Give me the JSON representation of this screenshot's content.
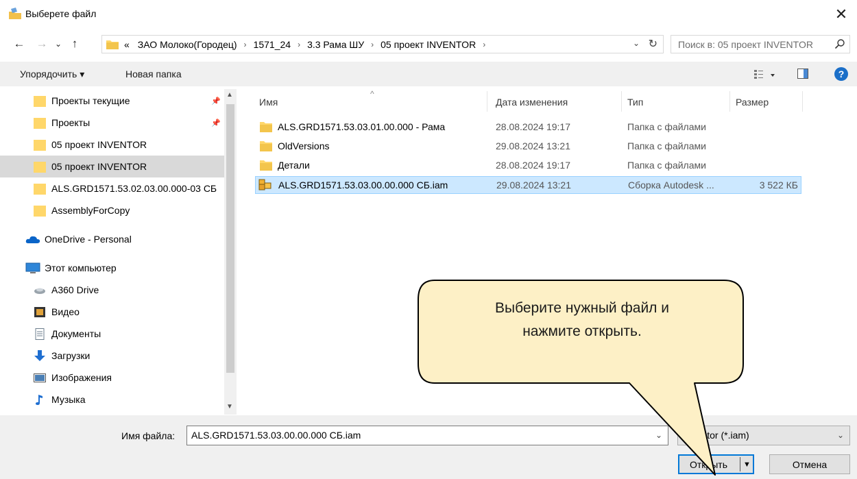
{
  "window": {
    "title": "Выберете файл",
    "close_glyph": "✕"
  },
  "nav": {
    "back_glyph": "←",
    "forward_glyph": "→",
    "recent_glyph": "⌄",
    "up_glyph": "↑",
    "breadcrumb": [
      "«",
      "ЗАО Молоко(Городец)",
      "1571_24",
      "3.3 Рама ШУ",
      "05 проект INVENTOR"
    ],
    "crumb_separator": "›",
    "dropdown_glyph": "⌄",
    "refresh_glyph": "↻",
    "search_placeholder": "Поиск в: 05 проект INVENTOR"
  },
  "toolbar": {
    "organize_label": "Упорядочить ▾",
    "new_folder_label": "Новая папка",
    "help_glyph": "?"
  },
  "sidebar": {
    "items": [
      {
        "label": "Проекты текущие",
        "icon": "folder-icon",
        "pinned": true
      },
      {
        "label": "Проекты",
        "icon": "folder-icon",
        "pinned": true
      },
      {
        "label": "05 проект INVENTOR",
        "icon": "folder-icon"
      },
      {
        "label": "05 проект INVENTOR",
        "icon": "folder-icon",
        "selected": true
      },
      {
        "label": "ALS.GRD1571.53.02.03.00.000-03 СБ",
        "icon": "folder-icon"
      },
      {
        "label": "AssemblyForCopy",
        "icon": "folder-icon"
      },
      {
        "label": "OneDrive - Personal",
        "icon": "cloud-icon"
      },
      {
        "label": "Этот компьютер",
        "icon": "computer-icon"
      },
      {
        "label": "A360 Drive",
        "icon": "drive-icon"
      },
      {
        "label": "Видео",
        "icon": "video-icon"
      },
      {
        "label": "Документы",
        "icon": "documents-icon"
      },
      {
        "label": "Загрузки",
        "icon": "downloads-icon"
      },
      {
        "label": "Изображения",
        "icon": "pictures-icon"
      },
      {
        "label": "Музыка",
        "icon": "music-icon"
      }
    ],
    "pin_glyph": "📌"
  },
  "filelist": {
    "columns": {
      "name": "Имя",
      "date": "Дата изменения",
      "type": "Тип",
      "size": "Размер"
    },
    "rows": [
      {
        "name": "ALS.GRD1571.53.03.01.00.000 - Рама",
        "date": "28.08.2024 19:17",
        "type": "Папка с файлами",
        "size": "",
        "icon": "folder-icon"
      },
      {
        "name": "OldVersions",
        "date": "29.08.2024 13:21",
        "type": "Папка с файлами",
        "size": "",
        "icon": "folder-icon"
      },
      {
        "name": "Детали",
        "date": "28.08.2024 19:17",
        "type": "Папка с файлами",
        "size": "",
        "icon": "folder-icon"
      },
      {
        "name": "ALS.GRD1571.53.03.00.00.000 СБ.iam",
        "date": "29.08.2024 13:21",
        "type": "Сборка Autodesk ...",
        "size": "3 522 КБ",
        "icon": "inventor-assembly-icon",
        "selected": true
      }
    ]
  },
  "bottom": {
    "filename_label": "Имя файла:",
    "filename_value": "ALS.GRD1571.53.03.00.00.000 СБ.iam",
    "filter_value": "Inventor (*.iam)",
    "open_label": "Открыть",
    "cancel_label": "Отмена"
  },
  "callout": {
    "line1": "Выберите нужный файл и",
    "line2": "нажмите открыть."
  },
  "colors": {
    "selection": "#cce8ff",
    "selection_border": "#99d1ff",
    "accent": "#0078d7",
    "folder": "#ffd76a",
    "callout_fill": "#fdf0c6"
  }
}
